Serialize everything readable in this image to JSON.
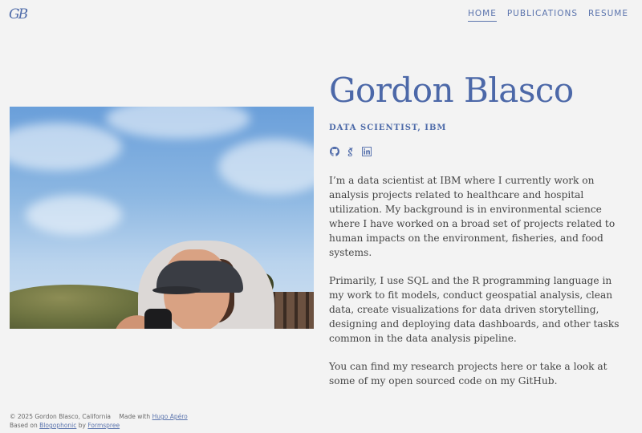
{
  "header": {
    "logo": "GB",
    "nav": [
      {
        "label": "HOME",
        "active": true
      },
      {
        "label": "PUBLICATIONS",
        "active": false
      },
      {
        "label": "RESUME",
        "active": false
      }
    ]
  },
  "profile": {
    "name": "Gordon Blasco",
    "role": "DATA SCIENTIST, IBM",
    "socials": [
      {
        "icon": "github-icon"
      },
      {
        "icon": "google-scholar-icon"
      },
      {
        "icon": "linkedin-icon"
      }
    ],
    "bio": [
      "I’m a data scientist at IBM where I currently work on analysis projects related to healthcare and hospital utilization. My background is in environmental science where I have worked on a broad set of projects related to human impacts on the environment, fisheries, and food systems.",
      "Primarily, I use SQL and the R programming language in my work to fit models, conduct geospatial analysis, clean data, create visualizations for data driven storytelling, designing and deploying data dashboards, and other tasks common in the data analysis pipeline.",
      "You can find my research projects here or take a look at some of my open sourced code on my GitHub."
    ]
  },
  "footer": {
    "copyright": "© 2025 Gordon Blasco, California",
    "made_with": "Made with",
    "made_with_link": "Hugo Apéro",
    "based_on": "Based on",
    "based_on_link": "Blogophonic",
    "by": "by",
    "by_link": "Formspree"
  },
  "colors": {
    "accent": "#4c68a8",
    "background": "#f3f3f3",
    "text": "#444444"
  }
}
